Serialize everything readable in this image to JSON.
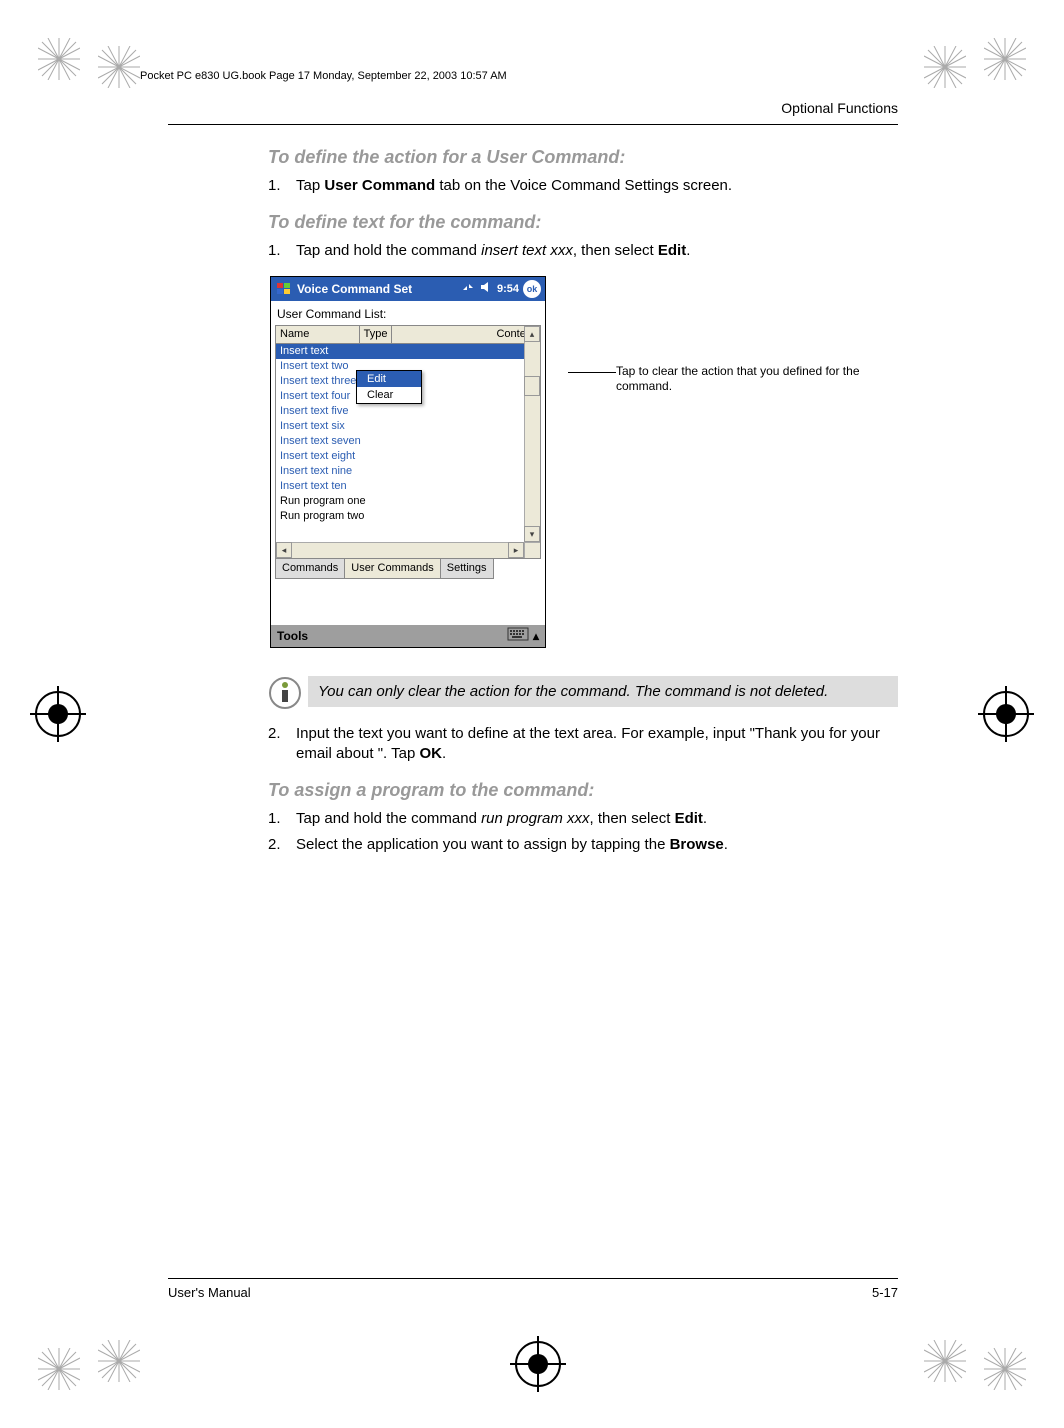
{
  "header_line": "Pocket PC e830 UG.book  Page 17  Monday, September 22, 2003  10:57 AM",
  "page_header": "Optional Functions",
  "headings": {
    "h1": "To define the action for a User Command:",
    "h2": "To define text for the command:",
    "h3": "To assign a program to the command:"
  },
  "steps": {
    "s1_1_a": "Tap ",
    "s1_1_b": "User Command",
    "s1_1_c": " tab on the Voice Command Settings screen.",
    "s2_1_a": "Tap and hold the command ",
    "s2_1_b": "insert text xxx",
    "s2_1_c": ", then select ",
    "s2_1_d": "Edit",
    "s2_1_e": ".",
    "s2_2_a": "Input the text you want to define at the text area. For example, input \"Thank you for your email about \". Tap ",
    "s2_2_b": "OK",
    "s2_2_c": ".",
    "s3_1_a": "Tap and hold the command ",
    "s3_1_b": "run program xxx",
    "s3_1_c": ", then select ",
    "s3_1_d": "Edit",
    "s3_1_e": ".",
    "s3_2_a": "Select the application you want to assign by tapping the ",
    "s3_2_b": "Browse",
    "s3_2_c": "."
  },
  "screenshot": {
    "title": "Voice Command Set",
    "time": "9:54",
    "ok": "ok",
    "user_command_list_label": "User Command List:",
    "headers": {
      "name": "Name",
      "type": "Type",
      "content": "Content"
    },
    "context_menu": {
      "edit": "Edit",
      "clear": "Clear"
    },
    "rows": [
      "Insert text ",
      "Insert text two",
      "Insert text three",
      "Insert text four",
      "Insert text five",
      "Insert text six",
      "Insert text seven",
      "Insert text eight",
      "Insert text nine",
      "Insert text ten",
      "Run program one",
      "Run program two"
    ],
    "tabs": {
      "commands": "Commands",
      "user_commands": "User Commands",
      "settings": "Settings"
    },
    "bottombar": "Tools"
  },
  "callout": "Tap to clear the action that you defined for the command.",
  "note": "You can only clear the action for the command. The command is not deleted.",
  "footer": {
    "left": "User's Manual",
    "right": "5-17"
  }
}
